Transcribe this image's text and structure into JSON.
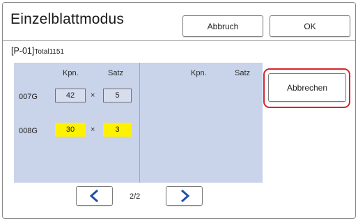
{
  "dialog": {
    "title": "Einzelblattmodus",
    "abort_label": "Abbruch",
    "ok_label": "OK"
  },
  "job": {
    "program_id": "[P-01]",
    "total": "Total1151"
  },
  "table": {
    "left_columns": {
      "copies": "Kpn.",
      "sets": "Satz"
    },
    "right_columns": {
      "copies": "Kpn.",
      "sets": "Satz"
    },
    "rows": [
      {
        "label": "007G",
        "copies": "42",
        "multiplier": "×",
        "sets": "5",
        "highlighted": false
      },
      {
        "label": "008G",
        "copies": "30",
        "multiplier": "×",
        "sets": "3",
        "highlighted": true
      }
    ]
  },
  "actions": {
    "cancel_label": "Abbrechen"
  },
  "pagination": {
    "page_text": "2/2",
    "prev_icon": "chevron-left-icon",
    "next_icon": "chevron-right-icon"
  },
  "colors": {
    "panel": "#c9d3ea",
    "highlight": "#fff200",
    "accent_outline": "#d8232a",
    "chevron": "#1f4fa8"
  }
}
